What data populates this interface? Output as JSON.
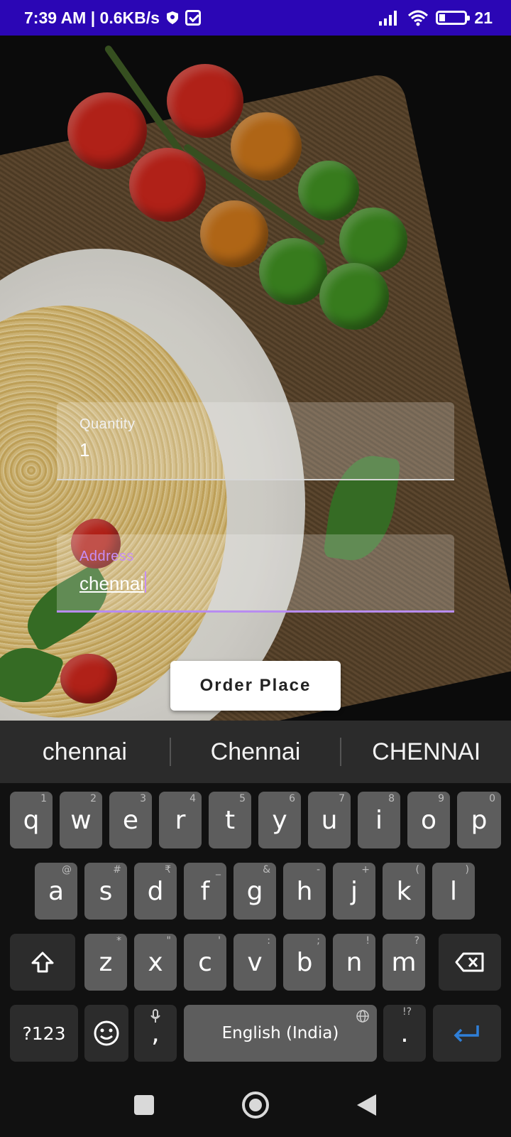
{
  "status_bar": {
    "time_speed": "7:39 AM | 0.6KB/s",
    "battery": "21"
  },
  "form": {
    "quantity": {
      "label": "Quantity",
      "value": "1"
    },
    "address": {
      "label": "Address",
      "value": "chennai"
    },
    "order_button": "Order Place"
  },
  "keyboard": {
    "suggestions": [
      "chennai",
      "Chennai",
      "CHENNAI"
    ],
    "row1": [
      {
        "k": "q",
        "h": "1"
      },
      {
        "k": "w",
        "h": "2"
      },
      {
        "k": "e",
        "h": "3"
      },
      {
        "k": "r",
        "h": "4"
      },
      {
        "k": "t",
        "h": "5"
      },
      {
        "k": "y",
        "h": "6"
      },
      {
        "k": "u",
        "h": "7"
      },
      {
        "k": "i",
        "h": "8"
      },
      {
        "k": "o",
        "h": "9"
      },
      {
        "k": "p",
        "h": "0"
      }
    ],
    "row2": [
      {
        "k": "a",
        "h": "@"
      },
      {
        "k": "s",
        "h": "#"
      },
      {
        "k": "d",
        "h": "₹"
      },
      {
        "k": "f",
        "h": "_"
      },
      {
        "k": "g",
        "h": "&"
      },
      {
        "k": "h",
        "h": "-"
      },
      {
        "k": "j",
        "h": "+"
      },
      {
        "k": "k",
        "h": "("
      },
      {
        "k": "l",
        "h": ")"
      }
    ],
    "row3": [
      {
        "k": "z",
        "h": "*"
      },
      {
        "k": "x",
        "h": "\""
      },
      {
        "k": "c",
        "h": "'"
      },
      {
        "k": "v",
        "h": ":"
      },
      {
        "k": "b",
        "h": ";"
      },
      {
        "k": "n",
        "h": "!"
      },
      {
        "k": "m",
        "h": "?"
      }
    ],
    "symbols_key": "?123",
    "comma_key": ",",
    "space_label": "English (India)",
    "period_key": ".",
    "period_hint": "!?"
  },
  "icons": {
    "shift": "shift-icon",
    "backspace": "backspace-icon",
    "emoji": "emoji-icon",
    "mic": "mic-icon",
    "globe": "globe-icon",
    "enter": "enter-icon",
    "nav_recents": "recents-icon",
    "nav_home": "home-icon",
    "nav_back": "back-icon"
  },
  "colors": {
    "status_bar": "#2b06b5",
    "accent": "#c78ef5",
    "enter_accent": "#2f7fd8"
  }
}
